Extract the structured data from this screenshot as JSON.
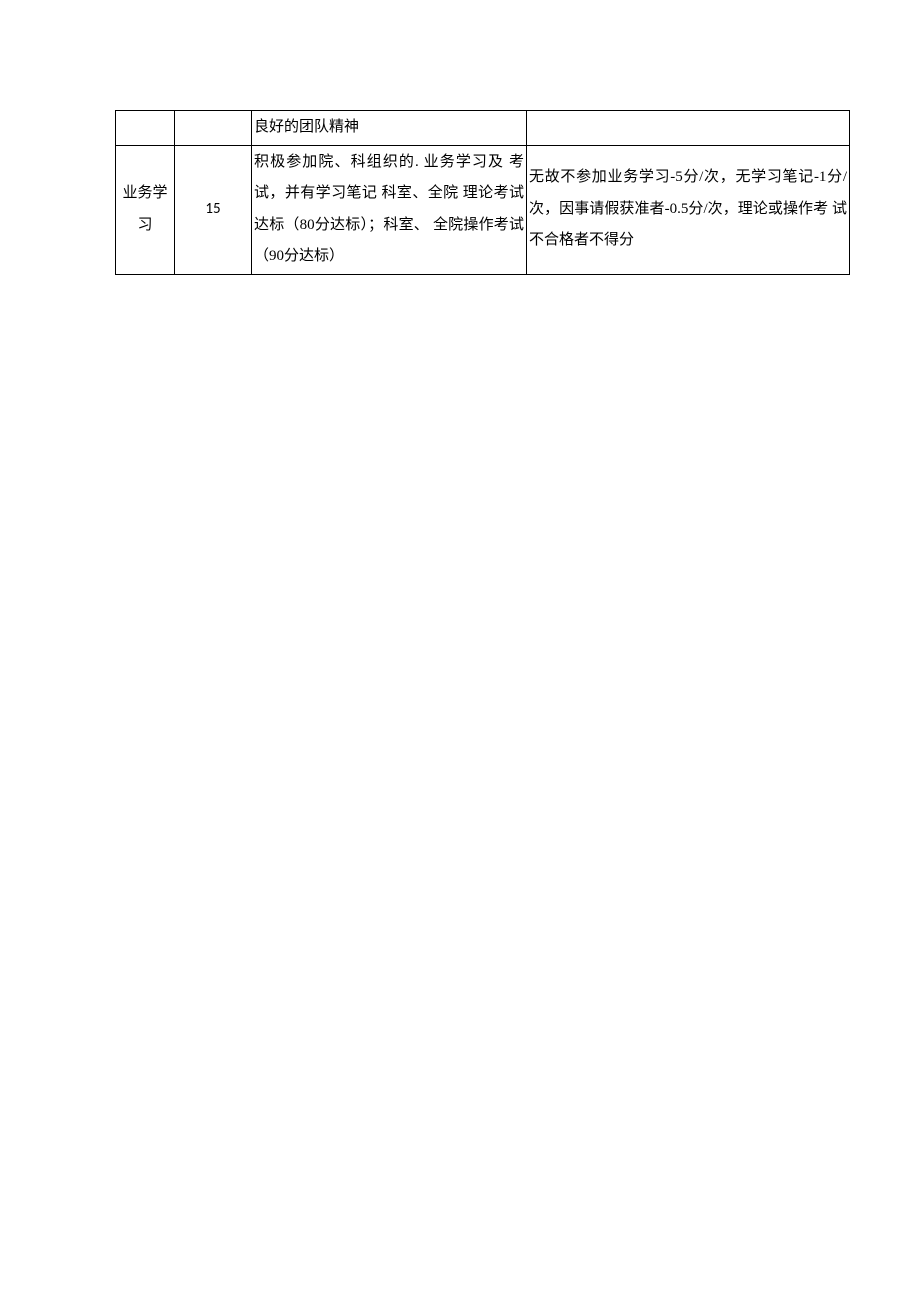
{
  "table": {
    "row1": {
      "col1": "",
      "col2": "",
      "col3": "良好的团队精神",
      "col4": ""
    },
    "row2": {
      "col1": "业务学习",
      "col2": "15",
      "col3": "积极参加院、科组织的. 业务学习及 考 试，并有学习笔记 科室、全院 理论考试达标（80分达标）；科室、  全院操作考试（90分达标）",
      "col4": "无故不参加业务学习-5分/次，无学习笔记-1分/ 次，因事请假获准者-0.5分/次，理论或操作考  试不合格者不得分"
    }
  }
}
